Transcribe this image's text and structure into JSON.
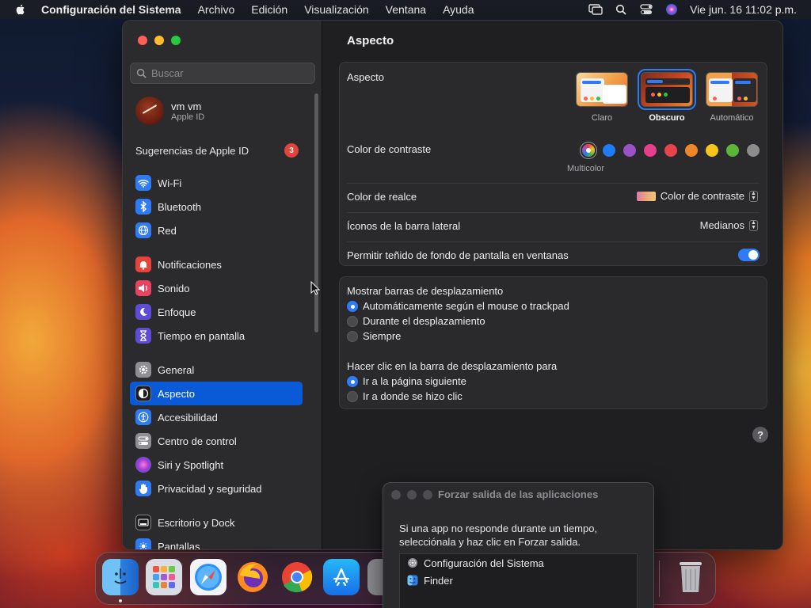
{
  "menubar": {
    "app_name": "Configuración del Sistema",
    "items": [
      "Archivo",
      "Edición",
      "Visualización",
      "Ventana",
      "Ayuda"
    ],
    "clock": "Vie jun. 16  11:02 p.m."
  },
  "sidebar": {
    "search_placeholder": "Buscar",
    "account": {
      "name": "vm vm",
      "sub": "Apple ID"
    },
    "suggestions": {
      "label": "Sugerencias de Apple ID",
      "count": "3"
    },
    "groups": [
      [
        {
          "label": "Wi-Fi",
          "icon": "wifi-icon",
          "color": "#2f7bf6"
        },
        {
          "label": "Bluetooth",
          "icon": "bluetooth-icon",
          "color": "#2f7bf6"
        },
        {
          "label": "Red",
          "icon": "globe-icon",
          "color": "#2f7bf6"
        }
      ],
      [
        {
          "label": "Notificaciones",
          "icon": "bell-icon",
          "color": "#e8433a"
        },
        {
          "label": "Sonido",
          "icon": "speaker-icon",
          "color": "#e8435f"
        },
        {
          "label": "Enfoque",
          "icon": "moon-icon",
          "color": "#5e4bd6"
        },
        {
          "label": "Tiempo en pantalla",
          "icon": "hourglass-icon",
          "color": "#5e4bd6"
        }
      ],
      [
        {
          "label": "General",
          "icon": "gear-icon",
          "color": "#8e8e93"
        },
        {
          "label": "Aspecto",
          "icon": "appearance-icon",
          "color": "#1c1c1e",
          "active": true
        },
        {
          "label": "Accesibilidad",
          "icon": "accessibility-icon",
          "color": "#2f7bf6"
        },
        {
          "label": "Centro de control",
          "icon": "control-center-icon",
          "color": "#8e8e93"
        },
        {
          "label": "Siri y Spotlight",
          "icon": "siri-icon",
          "color": "#c13bd1"
        },
        {
          "label": "Privacidad y seguridad",
          "icon": "hand-icon",
          "color": "#2f7bf6"
        }
      ],
      [
        {
          "label": "Escritorio y Dock",
          "icon": "dock-icon",
          "color": "#1c1c1e"
        },
        {
          "label": "Pantallas",
          "icon": "display-icon",
          "color": "#2f7bf6"
        }
      ]
    ]
  },
  "main": {
    "title": "Aspecto",
    "appearance": {
      "label": "Aspecto",
      "options": [
        {
          "label": "Claro",
          "selected": false
        },
        {
          "label": "Obscuro",
          "selected": true
        },
        {
          "label": "Automático",
          "selected": false
        }
      ]
    },
    "accent": {
      "label": "Color de contraste",
      "selected_caption": "Multicolor",
      "colors": [
        "multicolor",
        "#1f7bf6",
        "#9b52c9",
        "#e6408c",
        "#e8434a",
        "#f0862a",
        "#f5c51a",
        "#5db53a",
        "#8c8c8c"
      ]
    },
    "highlight": {
      "label": "Color de realce",
      "value": "Color de contraste"
    },
    "sidebar_icons": {
      "label": "Íconos de la barra lateral",
      "value": "Medianos"
    },
    "wallpaper_tint": {
      "label": "Permitir teñido de fondo de pantalla en ventanas",
      "on": true
    },
    "scrollbars": {
      "label": "Mostrar barras de desplazamiento",
      "options": [
        {
          "label": "Automáticamente según el mouse o trackpad",
          "selected": true
        },
        {
          "label": "Durante el desplazamiento",
          "selected": false
        },
        {
          "label": "Siempre",
          "selected": false
        }
      ]
    },
    "click_scroll": {
      "label": "Hacer clic en la barra de desplazamiento para",
      "options": [
        {
          "label": "Ir a la página siguiente",
          "selected": true
        },
        {
          "label": "Ir a donde se hizo clic",
          "selected": false
        }
      ]
    },
    "help": "?"
  },
  "force_quit": {
    "title": "Forzar salida de las aplicaciones",
    "message": "Si una app no responde durante un tiempo, selecciónala y haz clic en Forzar salida.",
    "apps": [
      {
        "name": "Configuración del Sistema",
        "icon": "system-settings-icon"
      },
      {
        "name": "Finder",
        "icon": "finder-icon"
      }
    ]
  },
  "dock": {
    "apps": [
      "finder-icon",
      "launchpad-icon",
      "safari-icon",
      "firefox-icon",
      "chrome-icon",
      "app-store-icon",
      "system-settings-icon",
      "trash-icon"
    ]
  }
}
